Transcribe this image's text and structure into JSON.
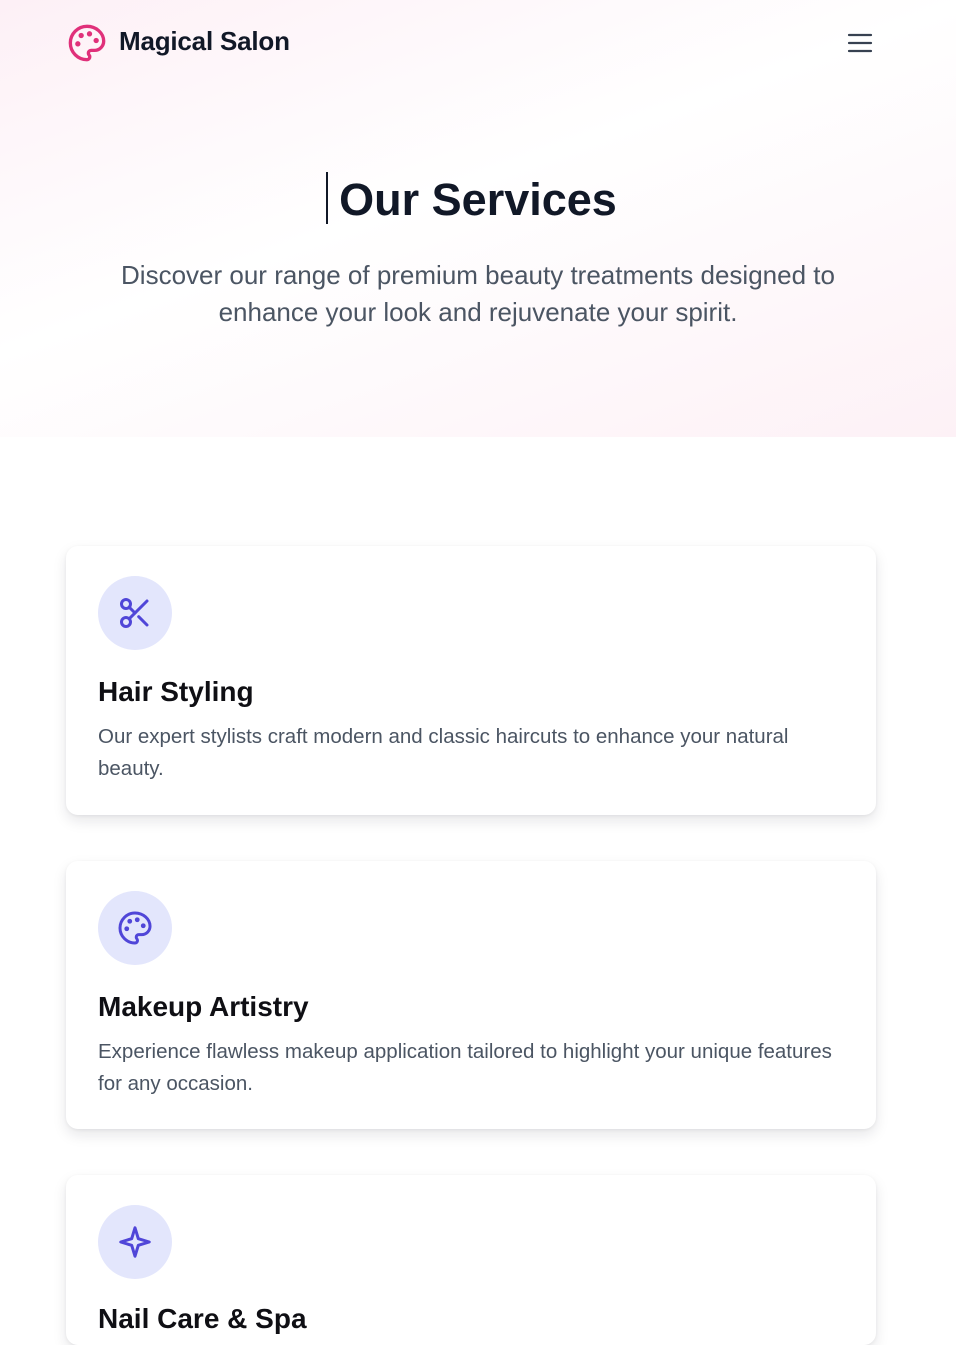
{
  "header": {
    "brand": "Magical Salon",
    "logo_icon": "palette-icon",
    "logo_color": "#e0307a",
    "menu_icon": "menu-icon"
  },
  "hero": {
    "title": "Our Services",
    "subtitle": "Discover our range of premium beauty treatments designed to enhance your look and rejuvenate your spirit."
  },
  "colors": {
    "accent": "#5046d8",
    "icon_background": "#e3e6fc",
    "heading": "#111827",
    "body_text": "#4b5563"
  },
  "services": [
    {
      "icon": "scissors-icon",
      "title": "Hair Styling",
      "description": "Our expert stylists craft modern and classic haircuts to enhance your natural beauty."
    },
    {
      "icon": "palette-icon",
      "title": "Makeup Artistry",
      "description": "Experience flawless makeup application tailored to highlight your unique features for any occasion."
    },
    {
      "icon": "sparkle-icon",
      "title": "Nail Care & Spa",
      "description": ""
    }
  ]
}
